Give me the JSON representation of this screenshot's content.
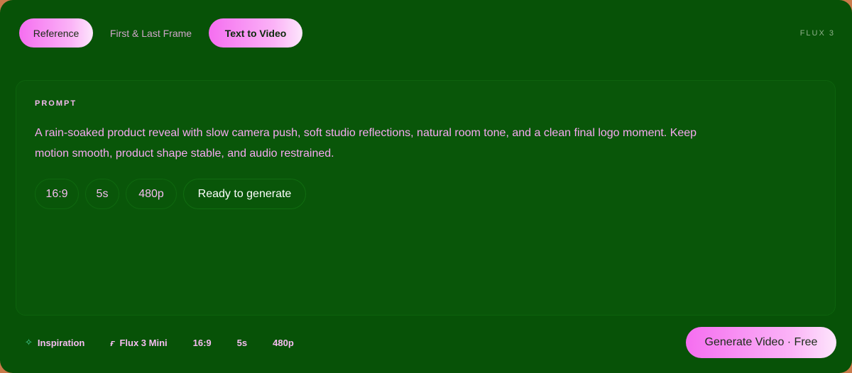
{
  "tabs": [
    {
      "label": "Reference"
    },
    {
      "label": "First & Last Frame"
    },
    {
      "label": "Text to Video"
    }
  ],
  "brand": "FLUX 3",
  "prompt": {
    "label": "PROMPT",
    "text": "A rain-soaked product reveal with slow camera push, soft studio reflections, natural room tone, and a clean final logo moment. Keep motion smooth, product shape stable, and audio restrained."
  },
  "chips": [
    "16:9",
    "5s",
    "480p"
  ],
  "status": "Ready to generate",
  "footer": {
    "inspiration": "Inspiration",
    "model": "Flux 3 Mini",
    "ratio": "16:9",
    "duration": "5s",
    "resolution": "480p",
    "icons": {
      "inspiration": "sparkle-icon",
      "model": "flux-logo-icon"
    }
  },
  "generate_button": "Generate Video · Free",
  "colors": {
    "panel": "#075207",
    "accent": "#f56ef0",
    "text": "#f7a9f1"
  }
}
